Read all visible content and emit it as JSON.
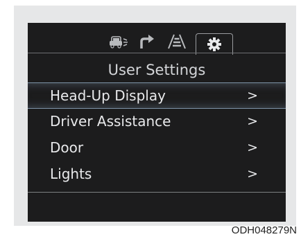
{
  "tabs": [
    {
      "icon": "car-driving-icon",
      "active": false
    },
    {
      "icon": "turn-arrow-icon",
      "active": false
    },
    {
      "icon": "lane-road-icon",
      "active": false
    },
    {
      "icon": "gear-icon",
      "active": true
    }
  ],
  "header": {
    "title": "User Settings"
  },
  "menu": {
    "items": [
      {
        "label": "Head-Up Display",
        "chevron": ">",
        "selected": true
      },
      {
        "label": "Driver Assistance",
        "chevron": ">",
        "selected": false
      },
      {
        "label": "Door",
        "chevron": ">",
        "selected": false
      },
      {
        "label": "Lights",
        "chevron": ">",
        "selected": false
      }
    ]
  },
  "caption": {
    "code": "ODH048279N"
  },
  "colors": {
    "screen_bg": "#1c1c1d",
    "text": "#e8e9eb",
    "selection_border": "#7d93a8",
    "panel_bg": "#e6e7e8"
  }
}
